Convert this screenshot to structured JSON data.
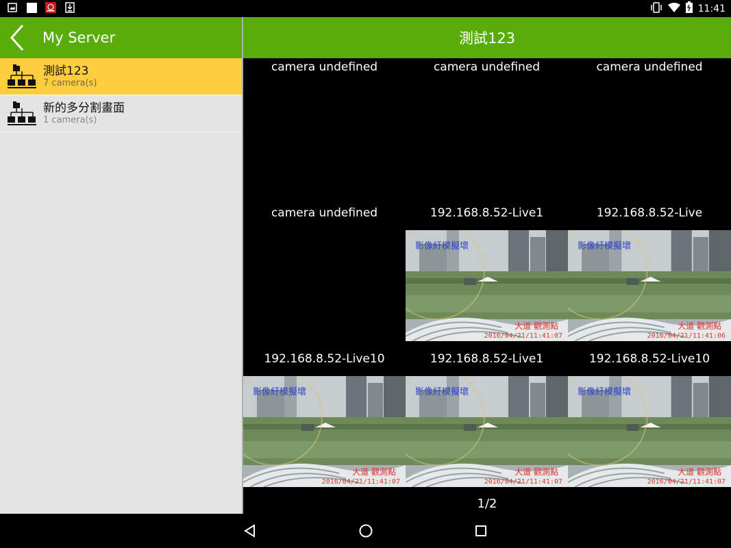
{
  "status_bar": {
    "time": "11:41",
    "left_icons": [
      "gallery-icon",
      "blank-app-icon",
      "app-logo-icon",
      "download-icon"
    ],
    "right_icons": [
      "vibrate-icon",
      "wifi-icon",
      "battery-icon"
    ]
  },
  "left_panel": {
    "title": "My Server",
    "servers": [
      {
        "name": "測試123",
        "count": "7 camera(s)",
        "selected": true
      },
      {
        "name": "新的多分割畫面",
        "count": "1 camera(s)",
        "selected": false
      }
    ]
  },
  "right_panel": {
    "title": "測試123",
    "cameras": [
      {
        "label": "camera undefined",
        "has_feed": false
      },
      {
        "label": "camera undefined",
        "has_feed": false
      },
      {
        "label": "camera undefined",
        "has_feed": false
      },
      {
        "label": "camera undefined",
        "has_feed": false
      },
      {
        "label": "192.168.8.52-Live1",
        "has_feed": true,
        "overlay_title": "影像紆模擬壞",
        "red_text": "大道 觀測點",
        "timestamp": "2016/04/21/11:41:07"
      },
      {
        "label": "192.168.8.52-Live",
        "has_feed": true,
        "overlay_title": "影像紆模擬壞",
        "red_text": "大道 觀測點",
        "timestamp": "2016/04/21/11:41:06"
      },
      {
        "label": "192.168.8.52-Live10",
        "has_feed": true,
        "overlay_title": "影像紆模擬壞",
        "red_text": "大道 觀測點",
        "timestamp": "2016/04/21/11:41:07"
      },
      {
        "label": "192.168.8.52-Live1",
        "has_feed": true,
        "overlay_title": "影像紆模擬壞",
        "red_text": "大道 觀測點",
        "timestamp": "2016/04/21/11:41:07"
      },
      {
        "label": "192.168.8.52-Live10",
        "has_feed": true,
        "overlay_title": "影像紆模擬壞",
        "red_text": "大道 觀測點",
        "timestamp": "2016/04/21/11:41:07"
      }
    ],
    "pager": "1/2"
  },
  "colors": {
    "header_green": "#58ad0b",
    "selected_yellow": "#fecd3d",
    "panel_gray": "#e4e4e4"
  },
  "nav_bar": {
    "buttons": [
      "back-triangle-icon",
      "home-circle-icon",
      "recents-square-icon"
    ]
  }
}
